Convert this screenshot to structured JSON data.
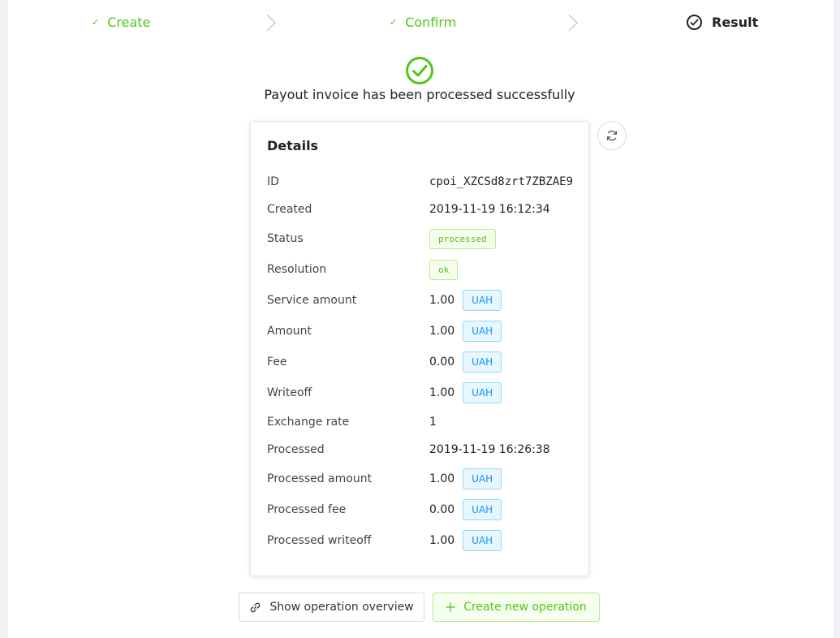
{
  "steps": [
    {
      "label": "Create",
      "state": "done"
    },
    {
      "label": "Confirm",
      "state": "done"
    },
    {
      "label": "Result",
      "state": "current"
    }
  ],
  "success_message": "Payout invoice has been processed successfully",
  "details": {
    "title": "Details",
    "rows": [
      {
        "label": "ID",
        "value": "cpoi_XZCSd8zrt7ZBZAE9"
      },
      {
        "label": "Created",
        "value": "2019-11-19 16:12:34"
      },
      {
        "label": "Status",
        "value": "processed"
      },
      {
        "label": "Resolution",
        "value": "ok"
      },
      {
        "label": "Service amount",
        "value": "1.00",
        "currency": "UAH"
      },
      {
        "label": "Amount",
        "value": "1.00",
        "currency": "UAH"
      },
      {
        "label": "Fee",
        "value": "0.00",
        "currency": "UAH"
      },
      {
        "label": "Writeoff",
        "value": "1.00",
        "currency": "UAH"
      },
      {
        "label": "Exchange rate",
        "value": "1"
      },
      {
        "label": "Processed",
        "value": "2019-11-19 16:26:38"
      },
      {
        "label": "Processed amount",
        "value": "1.00",
        "currency": "UAH"
      },
      {
        "label": "Processed fee",
        "value": "0.00",
        "currency": "UAH"
      },
      {
        "label": "Processed writeoff",
        "value": "1.00",
        "currency": "UAH"
      }
    ]
  },
  "actions": {
    "overview_label": "Show operation overview",
    "create_label": "Create new operation"
  },
  "icons": {
    "step_done": "check-icon",
    "step_current": "check-circle-icon",
    "separator": "chevron-right-icon",
    "success": "check-circle-icon",
    "refresh": "refresh-icon",
    "overview": "link-icon",
    "create": "plus-icon"
  },
  "colors": {
    "success": "#52c41a",
    "info": "#1890ff"
  }
}
